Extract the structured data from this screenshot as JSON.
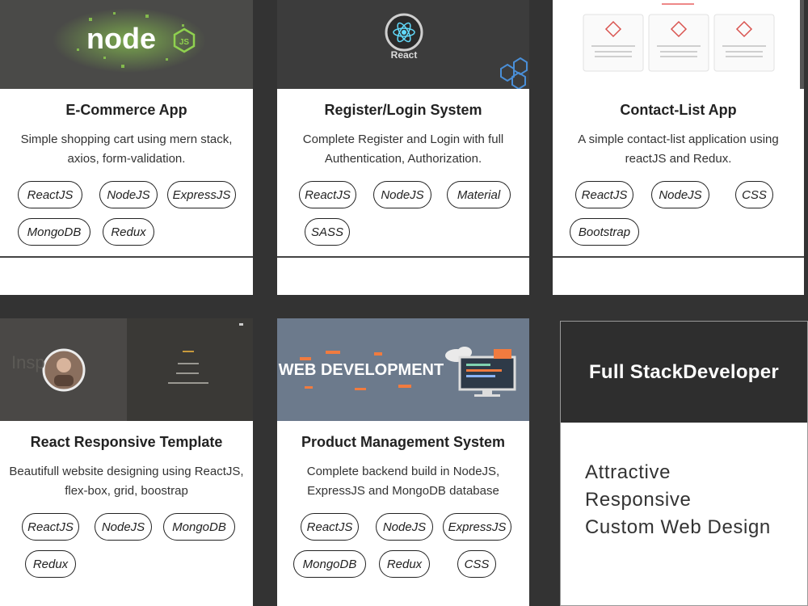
{
  "projects": [
    {
      "title": "E-Commerce App",
      "description": "Simple shopping cart using mern stack, axios, form-validation.",
      "thumbnail_text": "node",
      "thumbnail_badge": "JS",
      "tags": [
        "ReactJS",
        "NodeJS",
        "ExpressJS",
        "MongoDB",
        "Redux"
      ]
    },
    {
      "title": "Register/Login System",
      "description": "Complete Register and Login with full Authentication, Authorization.",
      "thumbnail_text": "React",
      "tags": [
        "ReactJS",
        "NodeJS",
        "Material",
        "SASS"
      ]
    },
    {
      "title": "Contact-List App",
      "description": "A simple contact-list application using reactJS and Redux.",
      "tags": [
        "ReactJS",
        "NodeJS",
        "CSS",
        "Bootstrap"
      ]
    },
    {
      "title": "React Responsive Template",
      "description": "Beautifull website designing using ReactJS, flex-box, grid, boostrap",
      "tags": [
        "ReactJS",
        "NodeJS",
        "MongoDB",
        "Redux"
      ]
    },
    {
      "title": "Product Management System",
      "description": "Complete backend build in NodeJS, ExpressJS and MongoDB database",
      "thumbnail_text": "WEB DEVELOPMENT",
      "tags": [
        "ReactJS",
        "NodeJS",
        "ExpressJS",
        "MongoDB",
        "Redux",
        "CSS"
      ]
    }
  ],
  "promo": {
    "heading": "Full StackDeveloper",
    "lines": [
      "Attractive",
      "Responsive",
      "Custom Web Design"
    ]
  },
  "colors": {
    "page_background": "#333333",
    "card_background": "#ffffff",
    "tag_border": "#222222",
    "promo_header": "#2e2e2e"
  }
}
